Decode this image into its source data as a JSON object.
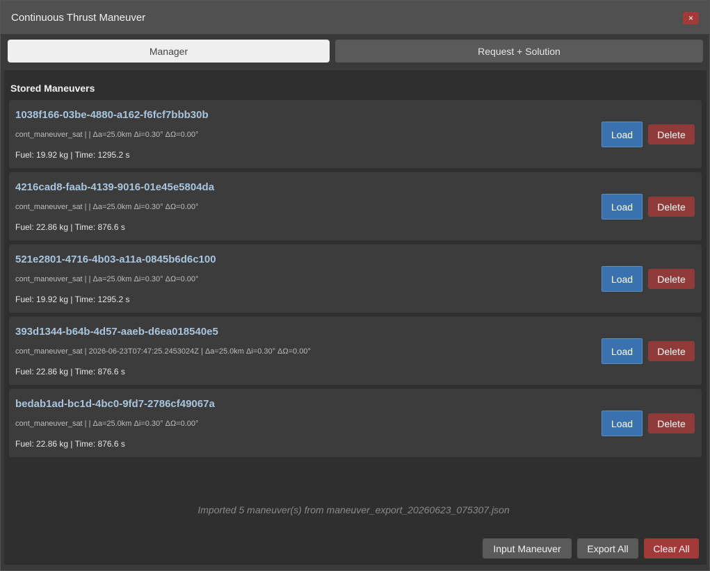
{
  "window": {
    "title": "Continuous Thrust Maneuver",
    "close_label": "×"
  },
  "tabs": [
    {
      "label": "Manager",
      "active": true
    },
    {
      "label": "Request + Solution",
      "active": false
    }
  ],
  "section_title": "Stored Maneuvers",
  "maneuvers": [
    {
      "id": "1038f166-03be-4880-a162-f6fcf7bbb30b",
      "meta": "cont_maneuver_sat |  | Δa=25.0km Δi=0.30° ΔΩ=0.00°",
      "fuel_time": "Fuel: 19.92 kg | Time: 1295.2 s",
      "load_label": "Load",
      "delete_label": "Delete"
    },
    {
      "id": "4216cad8-faab-4139-9016-01e45e5804da",
      "meta": "cont_maneuver_sat |  | Δa=25.0km Δi=0.30° ΔΩ=0.00°",
      "fuel_time": "Fuel: 22.86 kg | Time: 876.6 s",
      "load_label": "Load",
      "delete_label": "Delete"
    },
    {
      "id": "521e2801-4716-4b03-a11a-0845b6d6c100",
      "meta": "cont_maneuver_sat |  | Δa=25.0km Δi=0.30° ΔΩ=0.00°",
      "fuel_time": "Fuel: 19.92 kg | Time: 1295.2 s",
      "load_label": "Load",
      "delete_label": "Delete"
    },
    {
      "id": "393d1344-b64b-4d57-aaeb-d6ea018540e5",
      "meta": "cont_maneuver_sat | 2026-06-23T07:47:25.2453024Z | Δa=25.0km Δi=0.30° ΔΩ=0.00°",
      "fuel_time": "Fuel: 22.86 kg | Time: 876.6 s",
      "load_label": "Load",
      "delete_label": "Delete"
    },
    {
      "id": "bedab1ad-bc1d-4bc0-9fd7-2786cf49067a",
      "meta": "cont_maneuver_sat |  | Δa=25.0km Δi=0.30° ΔΩ=0.00°",
      "fuel_time": "Fuel: 22.86 kg | Time: 876.6 s",
      "load_label": "Load",
      "delete_label": "Delete"
    }
  ],
  "status_message": "Imported 5 maneuver(s) from maneuver_export_20260623_075307.json",
  "footer": {
    "import_label": "Input Maneuver",
    "export_label": "Export All",
    "clear_label": "Clear All"
  }
}
